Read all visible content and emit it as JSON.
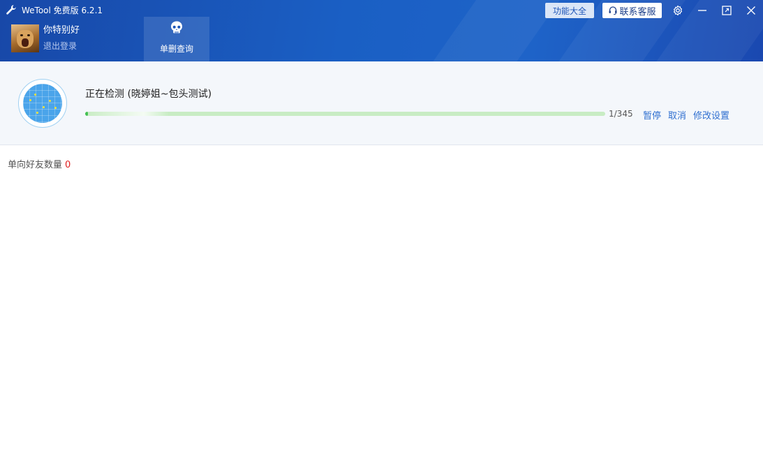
{
  "titlebar": {
    "app_title": "WeTool 免费版 6.2.1",
    "features_label": "功能大全",
    "support_label": "联系客服"
  },
  "user": {
    "name": "你特别好",
    "logout_label": "退出登录"
  },
  "tabs": [
    {
      "label": "单删查询",
      "active": true,
      "icon": "skull-icon"
    }
  ],
  "status": {
    "title": "正在检测 (晓婷姐~包头测试)",
    "progress_current": 1,
    "progress_total": 345,
    "progress_text": "1/345",
    "actions": {
      "pause": "暂停",
      "cancel": "取消",
      "settings": "修改设置"
    }
  },
  "summary": {
    "label": "单向好友数量",
    "count": "0"
  },
  "colors": {
    "header_blue": "#1a5fc4",
    "link_blue": "#2f6fd0",
    "count_red": "#e02020",
    "progress_green": "#3fbf4f"
  }
}
